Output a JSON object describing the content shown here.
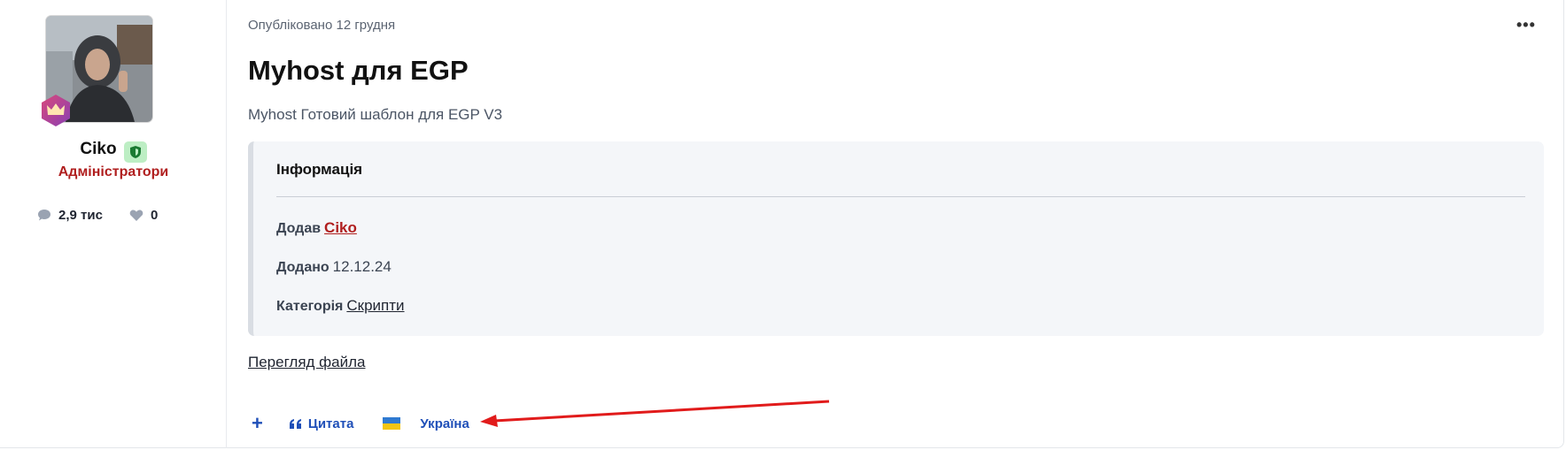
{
  "post": {
    "posted_label": "Опубліковано 12 грудня",
    "more_label": "•••",
    "title": "Myhost для EGP",
    "description": "Myhost Готовий шаблон для EGP V3"
  },
  "author": {
    "name": "Ciko",
    "role": "Адміністратори",
    "posts_count": "2,9 тис",
    "likes_count": "0",
    "role_color": "#b01f1f"
  },
  "info": {
    "heading": "Інформація",
    "added_by_label": "Додав",
    "added_by_value": "Ciko",
    "added_on_label": "Додано",
    "added_on_value": "12.12.24",
    "category_label": "Категорія",
    "category_value": "Скрипти"
  },
  "links": {
    "view_file": "Перегляд файла"
  },
  "actions": {
    "plus_label": "+",
    "quote_label": "Цитата",
    "reaction_label": "Україна"
  },
  "colors": {
    "accent": "#1f4fb8",
    "annotation_arrow": "#e11b1b"
  },
  "icons": {
    "more": "ellipsis-icon",
    "shield": "shield-icon",
    "rank": "crown-badge-icon",
    "posts": "comment-icon",
    "likes": "heart-icon",
    "quote": "quote-icon",
    "flag": "ukraine-flag-icon"
  }
}
